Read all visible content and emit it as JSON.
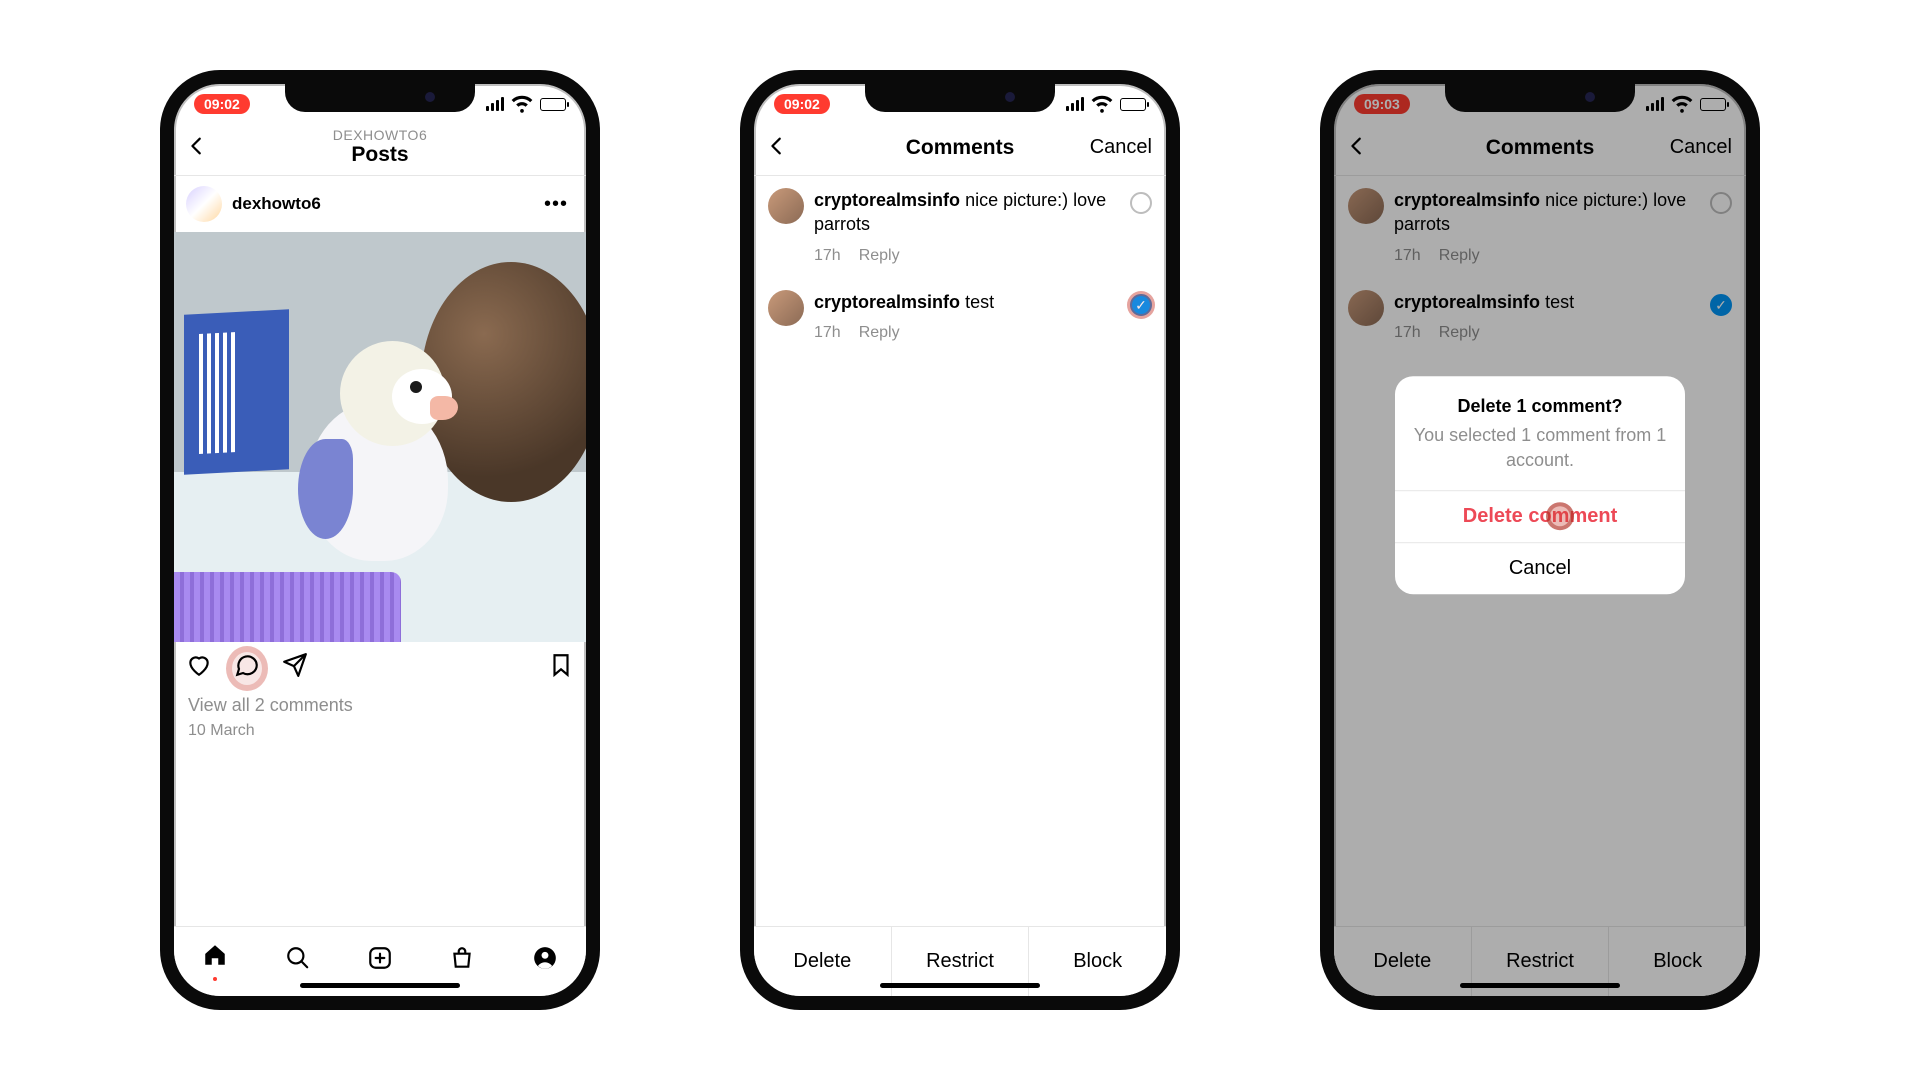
{
  "phone1": {
    "time": "09:02",
    "nav_subtitle": "DEXHOWTO6",
    "nav_title": "Posts",
    "post_user": "dexhowto6",
    "view_all": "View all 2 comments",
    "date": "10 March"
  },
  "phone2": {
    "time": "09:02",
    "nav_title": "Comments",
    "nav_cancel": "Cancel",
    "comments": [
      {
        "user": "cryptorealmsinfo",
        "text": "nice picture:) love parrots",
        "age": "17h",
        "reply": "Reply",
        "selected": false
      },
      {
        "user": "cryptorealmsinfo",
        "text": "test",
        "age": "17h",
        "reply": "Reply",
        "selected": true
      }
    ],
    "actions": {
      "delete": "Delete",
      "restrict": "Restrict",
      "block": "Block"
    }
  },
  "phone3": {
    "time": "09:03",
    "nav_title": "Comments",
    "nav_cancel": "Cancel",
    "comments": [
      {
        "user": "cryptorealmsinfo",
        "text": "nice picture:) love parrots",
        "age": "17h",
        "reply": "Reply",
        "selected": false
      },
      {
        "user": "cryptorealmsinfo",
        "text": "test",
        "age": "17h",
        "reply": "Reply",
        "selected": true
      }
    ],
    "actions": {
      "delete": "Delete",
      "restrict": "Restrict",
      "block": "Block"
    },
    "dialog": {
      "title": "Delete 1 comment?",
      "message": "You selected 1 comment from 1 account.",
      "delete": "Delete comment",
      "cancel": "Cancel"
    }
  }
}
